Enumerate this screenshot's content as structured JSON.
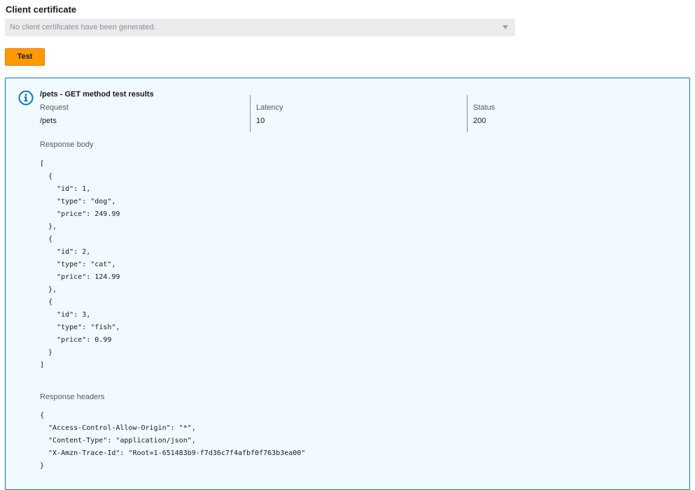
{
  "client_certificate": {
    "label": "Client certificate",
    "select_value": "No client certificates have been generated."
  },
  "test_button": {
    "label": "Test"
  },
  "results": {
    "title": "/pets - GET method test results",
    "request_label": "Request",
    "request_value": "/pets",
    "latency_label": "Latency",
    "latency_value": "10",
    "status_label": "Status",
    "status_value": "200",
    "response_body_label": "Response body",
    "response_body_lines": [
      "[",
      "  {",
      "    \"id\": 1,",
      "    \"type\": \"dog\",",
      "    \"price\": 249.99",
      "  },",
      "  {",
      "    \"id\": 2,",
      "    \"type\": \"cat\",",
      "    \"price\": 124.99",
      "  },",
      "  {",
      "    \"id\": 3,",
      "    \"type\": \"fish\",",
      "    \"price\": 0.99",
      "  }",
      "]"
    ],
    "response_headers_label": "Response headers",
    "response_headers_lines": [
      "{",
      "  \"Access-Control-Allow-Origin\": \"*\",",
      "  \"Content-Type\": \"application/json\",",
      "  \"X-Amzn-Trace-Id\": \"Root=1-651483b9-f7d36c7f4afbf0f763b3ea00\"",
      "}"
    ]
  },
  "colors": {
    "accent_button": "#ff9900",
    "info_border": "#0073bb",
    "info_background": "#f1faff"
  },
  "icons": {
    "info": "info-circle-icon",
    "dropdown": "caret-down-icon"
  }
}
